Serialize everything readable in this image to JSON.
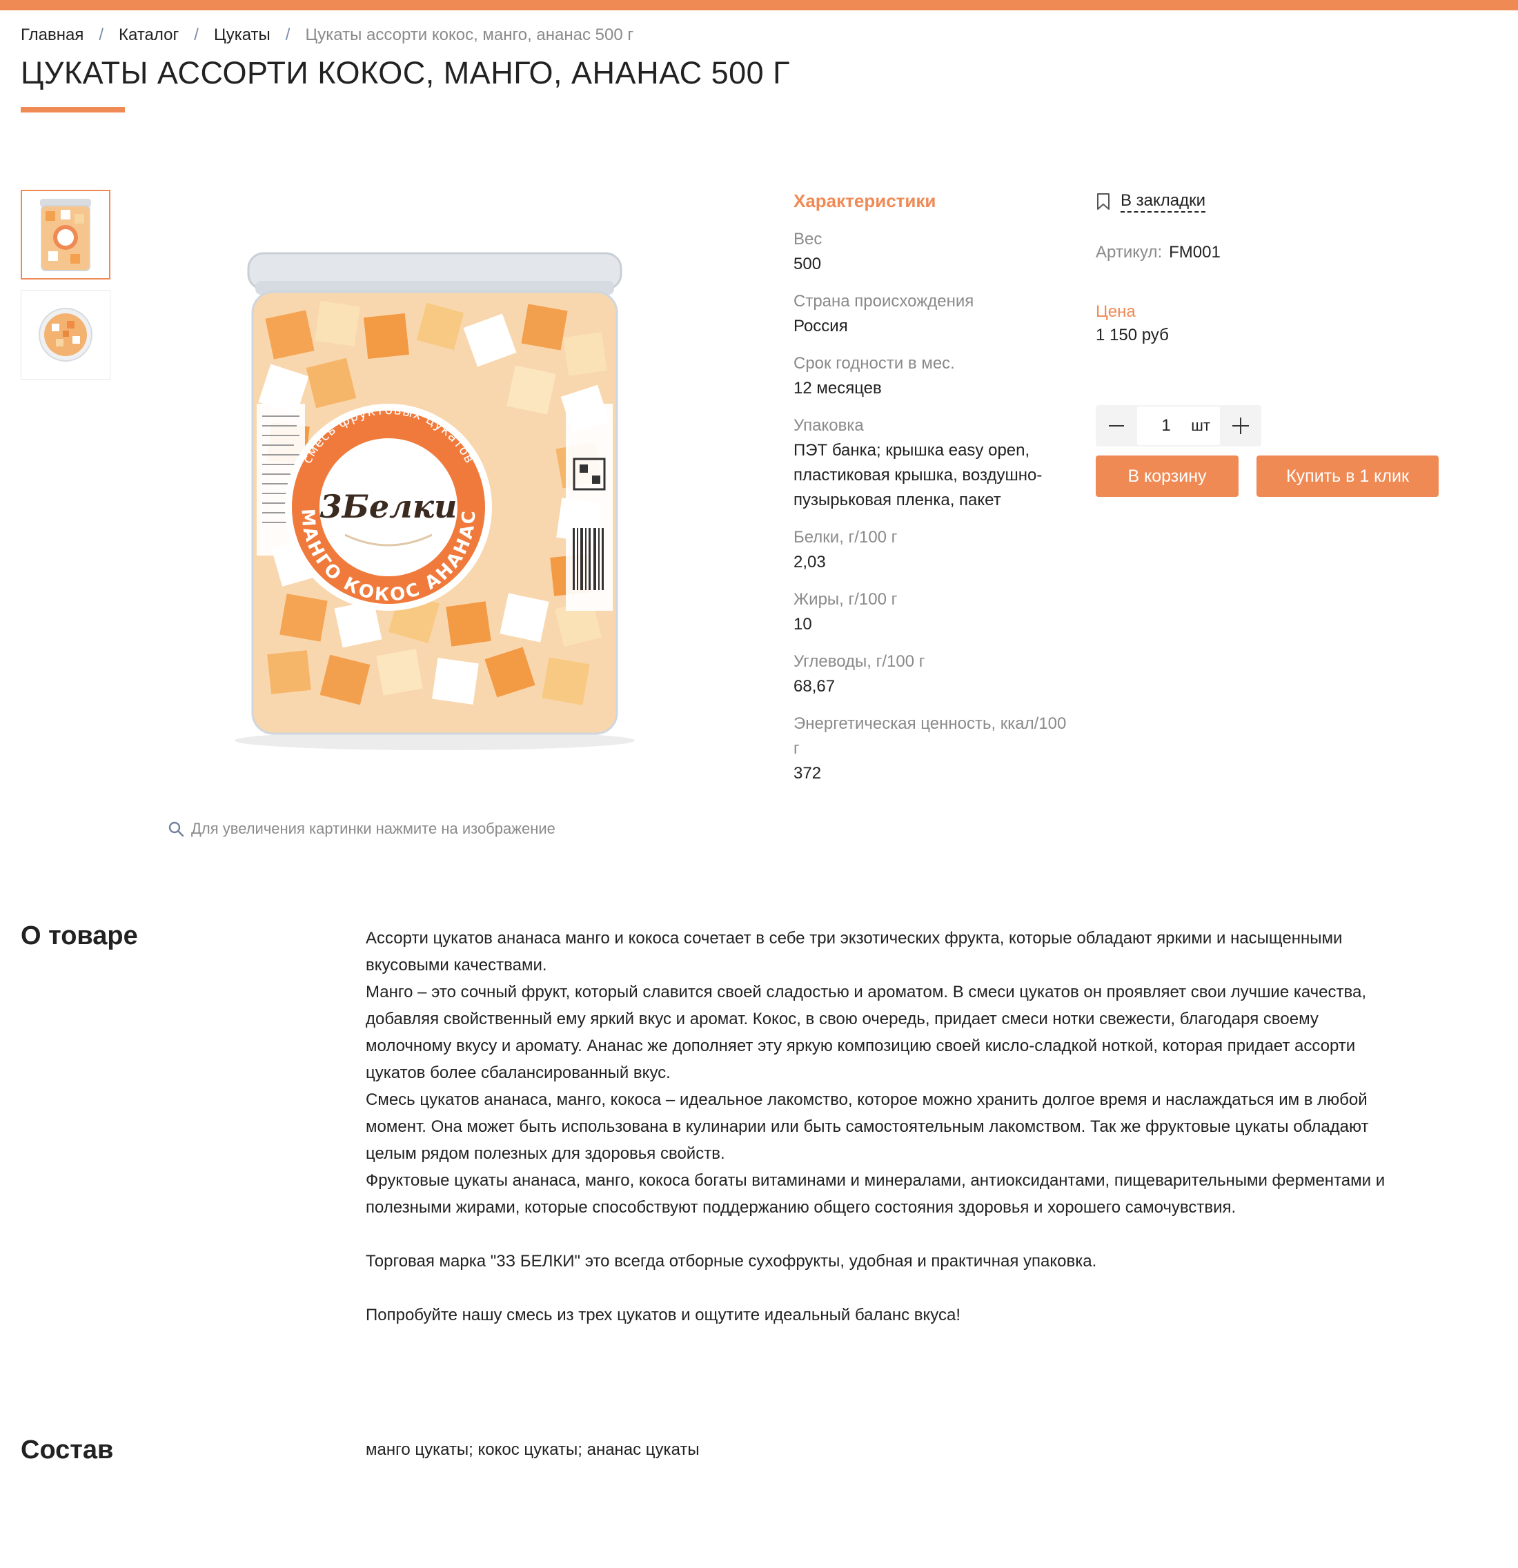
{
  "colors": {
    "accent": "#f08a55",
    "muted": "#8a8a8a",
    "text": "#222222"
  },
  "breadcrumb": {
    "items": [
      "Главная",
      "Каталог",
      "Цукаты"
    ],
    "separator": "/",
    "current": "Цукаты ассорти кокос, манго, ананас 500 г"
  },
  "product": {
    "title": "ЦУКАТЫ АССОРТИ КОКОС, МАНГО, АНАНАС 500 Г",
    "zoom_hint": "Для увеличения картинки нажмите на изображение",
    "image": {
      "brand": "3Белки",
      "arc_top": "смесь фруктовых цукатов",
      "arc_bottom": "МАНГО КОКОС АНАНАС"
    }
  },
  "specs": {
    "title": "Характеристики",
    "rows": [
      {
        "label": "Вес",
        "value": "500"
      },
      {
        "label": "Страна происхождения",
        "value": "Россия"
      },
      {
        "label": "Срок годности в мес.",
        "value": "12 месяцев"
      },
      {
        "label": "Упаковка",
        "value": "ПЭТ банка; крышка easy open, пластиковая крышка, воздушно-пузырьковая пленка, пакет"
      },
      {
        "label": "Белки, г/100 г",
        "value": "2,03"
      },
      {
        "label": "Жиры, г/100 г",
        "value": "10"
      },
      {
        "label": "Углеводы, г/100 г",
        "value": "68,67"
      },
      {
        "label": "Энергетическая ценность, ккал/100 г",
        "value": "372"
      }
    ]
  },
  "purchase": {
    "bookmark_label": "В закладки",
    "sku_label": "Артикул:",
    "sku_value": "FM001",
    "price_label": "Цена",
    "price_value": "1 150 руб",
    "quantity": "1",
    "unit": "шт",
    "cart_button": "В корзину",
    "one_click_button": "Купить в 1 клик"
  },
  "about": {
    "title": "О товаре",
    "paragraphs": [
      "Ассорти цукатов ананаса манго и кокоса сочетает в себе три экзотических фрукта, которые обладают яркими и насыщенными вкусовыми качествами.",
      "Манго – это сочный фрукт, который славится своей сладостью и ароматом. В смеси цукатов он проявляет свои лучшие качества, добавляя свойственный ему яркий вкус и аромат. Кокос, в свою очередь, придает смеси нотки свежести, благодаря своему молочному вкусу и аромату. Ананас же дополняет эту яркую композицию своей кисло-сладкой ноткой, которая придает ассорти цукатов более сбалансированный вкус.",
      "Смесь цукатов ананаса, манго, кокоса – идеальное лакомство, которое можно хранить долгое время и наслаждаться им в любой момент. Она может быть использована в кулинарии или быть самостоятельным лакомством. Так же фруктовые цукаты обладают целым рядом полезных для здоровья свойств.",
      "Фруктовые цукаты ананаса, манго, кокоса богаты витаминами и минералами, антиоксидантами, пищеварительными ферментами и полезными жирами, которые способствуют поддержанию общего состояния здоровья и хорошего самочувствия.",
      "Торговая марка \"3З БЕЛКИ\" это всегда отборные сухофрукты, удобная и практичная упаковка.",
      "Попробуйте нашу смесь из трех цукатов и ощутите идеальный баланс вкуса!"
    ]
  },
  "composition": {
    "title": "Состав",
    "text": "манго цукаты; кокос цукаты; ананас цукаты"
  }
}
